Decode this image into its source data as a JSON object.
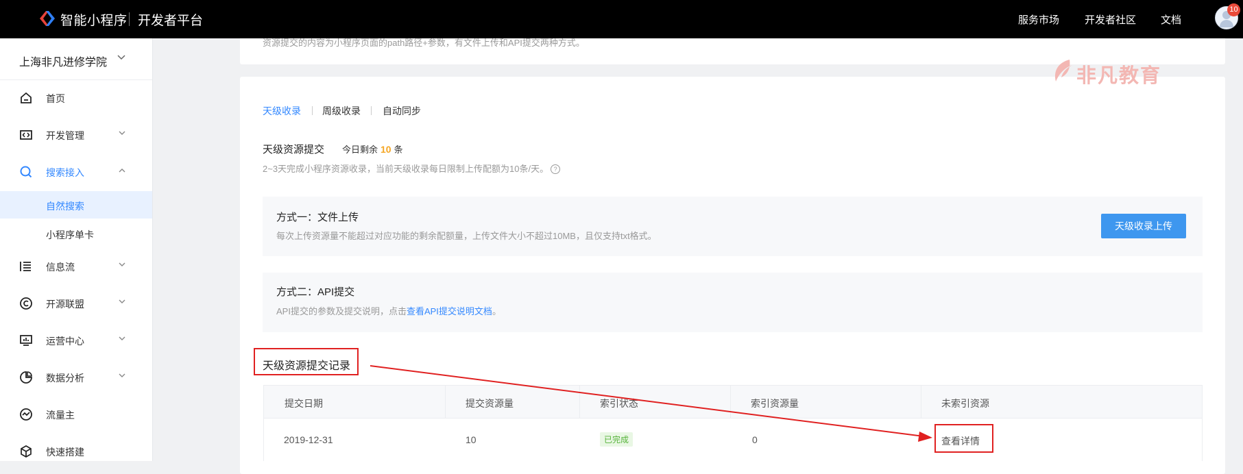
{
  "topbar": {
    "brand": "智能小程序",
    "brand_sub": "开发者平台",
    "nav": [
      "服务市场",
      "开发者社区",
      "文档"
    ],
    "badge_count": "10"
  },
  "sidebar": {
    "org_name": "上海非凡进修学院",
    "items": [
      {
        "label": "首页",
        "icon": "home-icon"
      },
      {
        "label": "开发管理",
        "icon": "code-icon"
      },
      {
        "label": "搜索接入",
        "icon": "search-icon"
      },
      {
        "label": "自然搜索"
      },
      {
        "label": "小程序单卡"
      },
      {
        "label": "信息流",
        "icon": "feed-icon"
      },
      {
        "label": "开源联盟",
        "icon": "copyright-icon"
      },
      {
        "label": "运营中心",
        "icon": "monitor-icon"
      },
      {
        "label": "数据分析",
        "icon": "pie-chart-icon"
      },
      {
        "label": "流量主",
        "icon": "traffic-icon"
      },
      {
        "label": "快速搭建",
        "icon": "cube-icon"
      }
    ]
  },
  "intro_text": "资源提交的内容为小程序页面的path路径+参数，有文件上传和API提交两种方式。",
  "watermark": "非凡教育",
  "tabs": [
    "天级收录",
    "周级收录",
    "自动同步"
  ],
  "section": {
    "title": "天级资源提交",
    "remain_prefix": "今日剩余",
    "remain_count": "10",
    "remain_suffix": "条",
    "desc": "2~3天完成小程序资源收录，当前天级收录每日限制上传配额为10条/天。"
  },
  "method1": {
    "title": "方式一：文件上传",
    "desc": "每次上传资源量不能超过对应功能的剩余配额量，上传文件大小不超过10MB，且仅支持txt格式。",
    "button": "天级收录上传"
  },
  "method2": {
    "title": "方式二：API提交",
    "desc_prefix": "API提交的参数及提交说明，点击",
    "link": "查看API提交说明文档",
    "desc_suffix": "。"
  },
  "records": {
    "title": "天级资源提交记录",
    "columns": [
      "提交日期",
      "提交资源量",
      "索引状态",
      "索引资源量",
      "未索引资源"
    ],
    "rows": [
      {
        "date": "2019-12-31",
        "count": "10",
        "status": "已完成",
        "indexed": "0",
        "action": "查看详情"
      }
    ]
  },
  "colors": {
    "accent": "#3388ff",
    "button": "#3e97ef",
    "highlight_number": "#f5a623",
    "annotation": "#e02020",
    "status_green": "#56b33a"
  }
}
